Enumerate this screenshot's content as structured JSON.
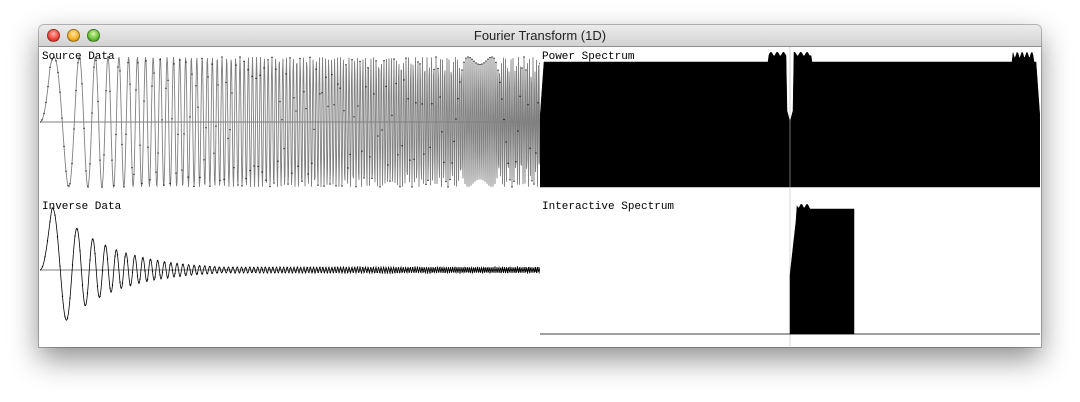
{
  "window": {
    "title": "Fourier Transform (1D)"
  },
  "controls": {
    "close": "close-button",
    "minimize": "minimize-button",
    "zoom": "zoom-button"
  },
  "panels": {
    "source_data": {
      "label": "Source Data"
    },
    "power_spectrum": {
      "label": "Power Spectrum"
    },
    "inverse_data": {
      "label": "Inverse Data"
    },
    "interactive_spectrum": {
      "label": "Interactive Spectrum"
    }
  },
  "colors": {
    "background": "#ffffff",
    "plot_line": "#000000",
    "source_fill": "#808080",
    "spectrum_fill": "#000000"
  }
}
